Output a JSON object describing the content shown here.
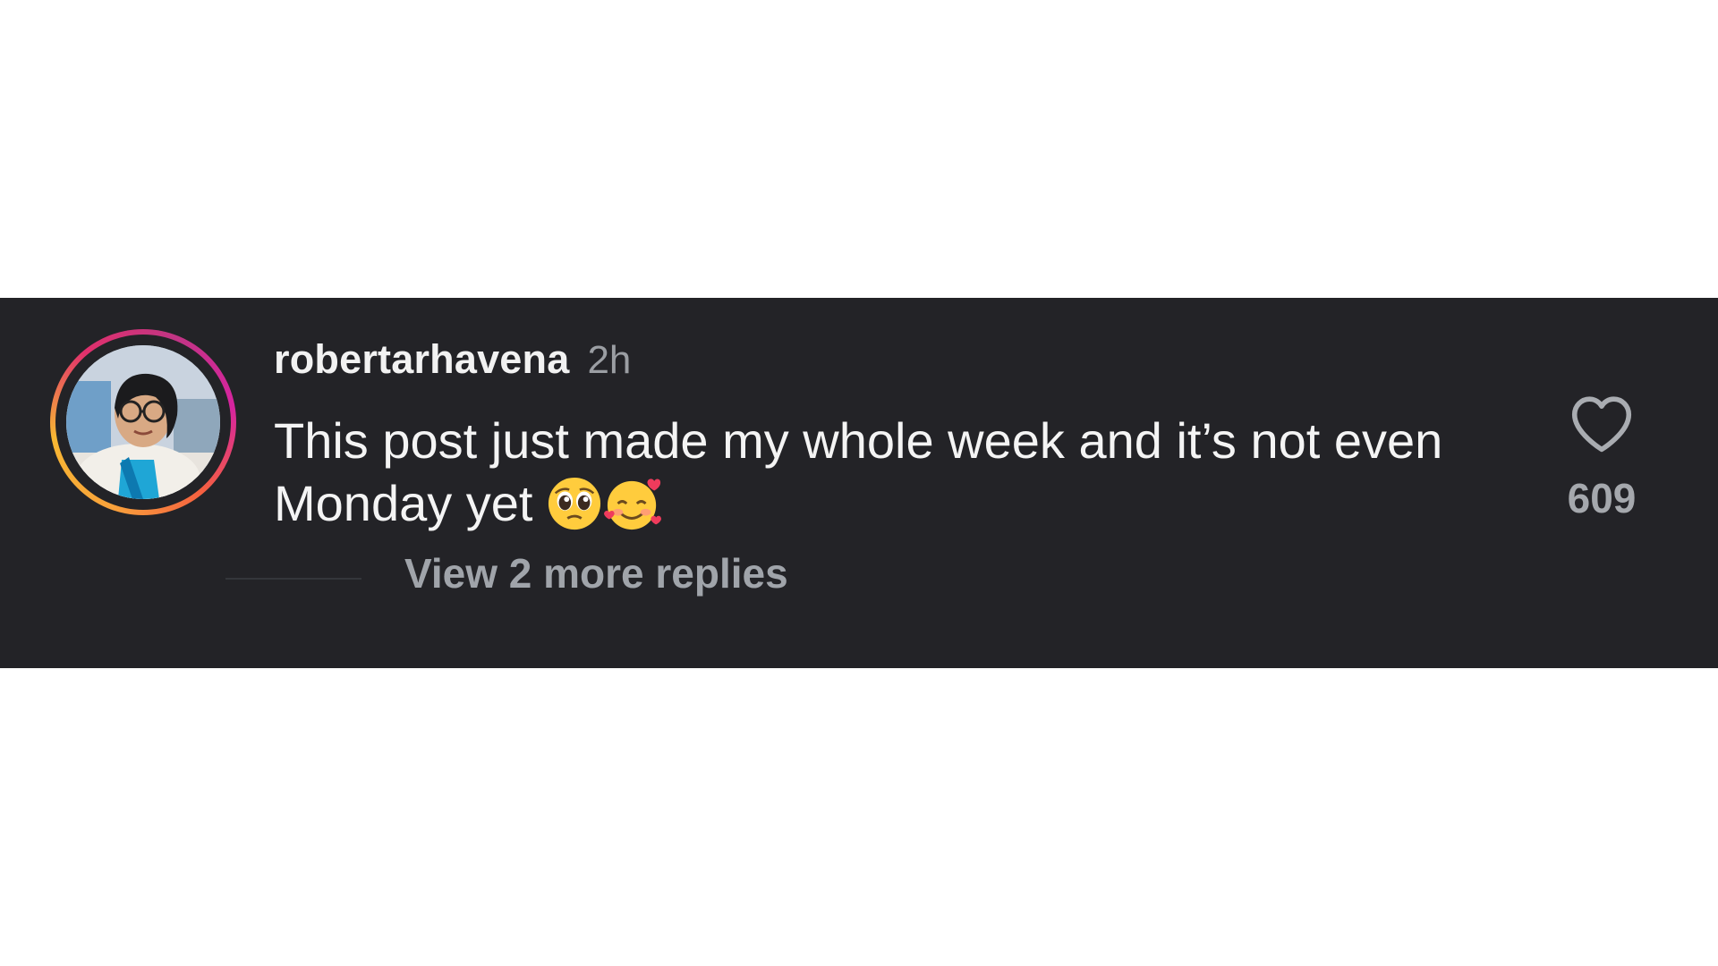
{
  "comment": {
    "username": "robertarhavena",
    "timestamp": "2h",
    "text": "This post just made my whole week and it’s not even Monday yet",
    "emojis": [
      "pleading-face",
      "smiling-face-with-hearts"
    ],
    "replies_label": "View 2 more replies",
    "like_count": "609",
    "liked": false
  },
  "icons": {
    "like": "heart-outline-icon",
    "avatar": "profile-photo"
  },
  "colors": {
    "background": "#232327",
    "text": "#f4f4f4",
    "muted": "#9b9ea3",
    "story_ring": [
      "#f9a23b",
      "#e1306c",
      "#c13584"
    ]
  }
}
